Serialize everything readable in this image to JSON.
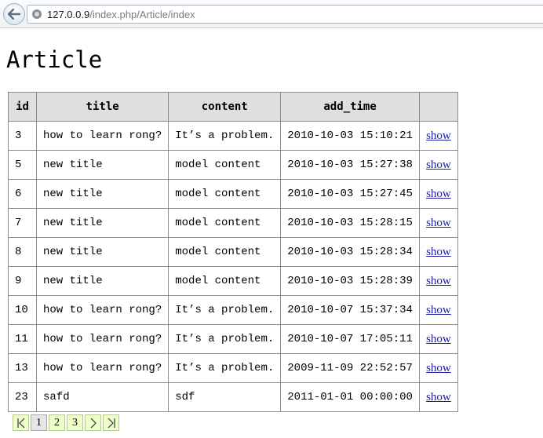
{
  "browser": {
    "url_host": "127.0.0.9",
    "url_path": "/index.php/Article/index"
  },
  "page": {
    "title": "Article"
  },
  "table": {
    "headers": [
      "id",
      "title",
      "content",
      "add_time",
      ""
    ],
    "rows": [
      {
        "id": "3",
        "title": "how to learn rong?",
        "content": "It’s a problem.",
        "add_time": "2010-10-03 15:10:21",
        "action": "show"
      },
      {
        "id": "5",
        "title": "new title",
        "content": "model content",
        "add_time": "2010-10-03 15:27:38",
        "action": "show"
      },
      {
        "id": "6",
        "title": "new title",
        "content": "model content",
        "add_time": "2010-10-03 15:27:45",
        "action": "show"
      },
      {
        "id": "7",
        "title": "new title",
        "content": "model content",
        "add_time": "2010-10-03 15:28:15",
        "action": "show"
      },
      {
        "id": "8",
        "title": "new title",
        "content": "model content",
        "add_time": "2010-10-03 15:28:34",
        "action": "show"
      },
      {
        "id": "9",
        "title": "new title",
        "content": "model content",
        "add_time": "2010-10-03 15:28:39",
        "action": "show"
      },
      {
        "id": "10",
        "title": "how to learn rong?",
        "content": "It’s a problem.",
        "add_time": "2010-10-07 15:37:34",
        "action": "show"
      },
      {
        "id": "11",
        "title": "how to learn rong?",
        "content": "It’s a problem.",
        "add_time": "2010-10-07 17:05:11",
        "action": "show"
      },
      {
        "id": "13",
        "title": "how to learn rong?",
        "content": "It’s a problem.",
        "add_time": "2009-11-09 22:52:57",
        "action": "show"
      },
      {
        "id": "23",
        "title": "safd",
        "content": "sdf",
        "add_time": "2011-01-01 00:00:00",
        "action": "show"
      }
    ]
  },
  "pager": {
    "pages": [
      "1",
      "2",
      "3"
    ],
    "current": "1"
  },
  "icons": {
    "back": "back-arrow-icon",
    "site": "globe-icon",
    "first": "first-page-icon",
    "next": "next-page-icon",
    "last": "last-page-icon"
  },
  "colors": {
    "header_bg": "#e0dfdd",
    "link": "#1f1f9e",
    "pager_bg": "#eeffcc"
  }
}
